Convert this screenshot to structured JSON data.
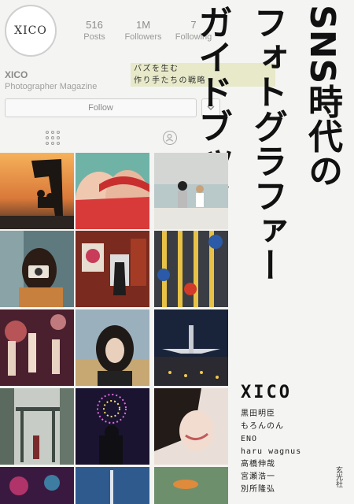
{
  "profile": {
    "logo_text": "XICO",
    "stats": [
      {
        "value": "516",
        "label": "Posts"
      },
      {
        "value": "1M",
        "label": "Followers"
      },
      {
        "value": "7",
        "label": "Following"
      }
    ],
    "name": "XICO",
    "subtitle": "Photographer Magazine",
    "follow_label": "Follow"
  },
  "tagline": [
    "バズを生む",
    "作り手たちの戦略"
  ],
  "title": [
    "SNS時代の",
    "フォトグラファー",
    "ガイドブック"
  ],
  "author_main": "XICO",
  "authors": [
    "黒田明臣",
    "もろんのん",
    "ENO",
    "haru wagnus",
    "高橋伸哉",
    "宮瀬浩一",
    "別所隆弘"
  ],
  "publisher": "玄光社",
  "icons": {
    "grid": "grid-icon",
    "tagged": "tagged-person-icon",
    "dropdown": "chevron-down-icon"
  }
}
